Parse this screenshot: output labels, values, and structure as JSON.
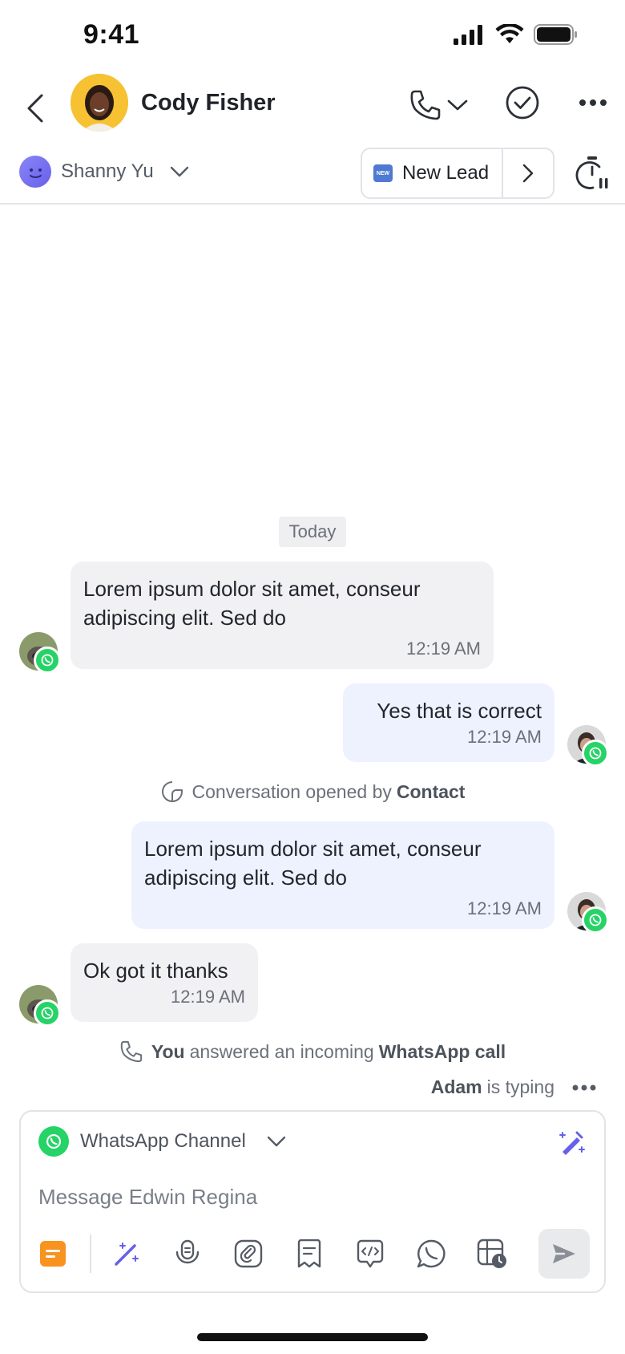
{
  "status_bar": {
    "time": "9:41"
  },
  "header": {
    "contact_name": "Cody Fisher"
  },
  "subheader": {
    "assignee": "Shanny Yu",
    "stage_badge": "NEW",
    "stage_label": "New Lead"
  },
  "conversation": {
    "date_label": "Today",
    "messages": [
      {
        "direction": "in",
        "text": "Lorem ipsum dolor sit amet, conseur adipiscing elit. Sed do",
        "time": "12:19 AM"
      },
      {
        "direction": "out",
        "text": "Yes that is correct",
        "time": "12:19 AM"
      },
      {
        "direction": "out",
        "text": "Lorem ipsum dolor sit amet, conseur adipiscing elit. Sed do",
        "time": "12:19 AM"
      },
      {
        "direction": "in",
        "text": "Ok got it thanks",
        "time": "12:19 AM"
      }
    ],
    "system_opened": {
      "text": "Conversation opened by",
      "actor": "Contact"
    },
    "system_call": {
      "actor": "You",
      "text": "answered an incoming",
      "channel": "WhatsApp call"
    },
    "typing": {
      "user": "Adam",
      "text": "is typing"
    }
  },
  "composer": {
    "channel_label": "WhatsApp Channel",
    "placeholder": "Message Edwin Regina"
  },
  "colors": {
    "whatsapp": "#25d366",
    "accent": "#6760ea",
    "incoming_bubble": "#f1f1f3",
    "outgoing_bubble": "#eef2fe",
    "note_orange": "#f7931e"
  }
}
